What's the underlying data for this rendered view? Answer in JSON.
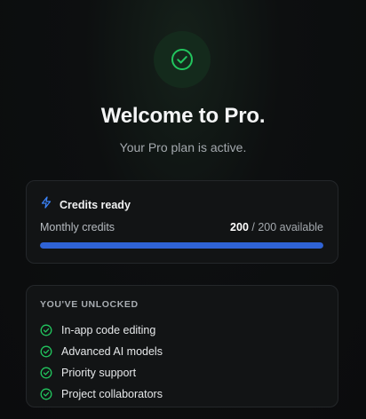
{
  "hero": {
    "icon": "check-circle-icon",
    "title": "Welcome to Pro.",
    "subtitle": "Your Pro plan is active."
  },
  "credits": {
    "icon": "lightning-icon",
    "heading": "Credits ready",
    "label": "Monthly credits",
    "used": "200",
    "separator": " / ",
    "total_text": "200 available",
    "fill_fraction": 1.0
  },
  "unlocked": {
    "heading": "YOU'VE UNLOCKED",
    "item_icon": "check-circle-icon",
    "items": [
      {
        "label": "In-app code editing"
      },
      {
        "label": "Advanced AI models"
      },
      {
        "label": "Priority support"
      },
      {
        "label": "Project collaborators"
      }
    ]
  },
  "colors": {
    "success": "#22c55e",
    "accent": "#2f63d6",
    "background": "#0b0c0d"
  }
}
